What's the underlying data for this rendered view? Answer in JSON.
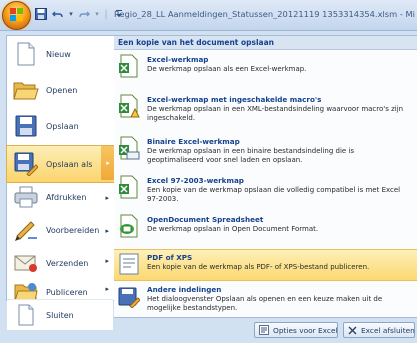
{
  "window": {
    "title": "Regio_28_LL Aanmeldingen_Statussen_20121119 1353314354.xlsm - Mi"
  },
  "quick_access": {
    "items": [
      "save-icon",
      "undo-icon",
      "redo-icon",
      "customize-icon"
    ],
    "separator": "|",
    "dropdown": "▾"
  },
  "office_menu": {
    "left_items": [
      {
        "id": "nieuw",
        "label": "Nieuw",
        "icon": "new-document-icon"
      },
      {
        "id": "openen",
        "label": "Openen",
        "icon": "open-folder-icon"
      },
      {
        "id": "opslaan",
        "label": "Opslaan",
        "icon": "save-disk-icon"
      },
      {
        "id": "opslaan-als",
        "label": "Opslaan als",
        "icon": "save-as-icon",
        "arrow": "▸",
        "active": true
      },
      {
        "id": "afdrukken",
        "label": "Afdrukken",
        "icon": "printer-icon",
        "arrow": "▸"
      },
      {
        "id": "voorbereiden",
        "label": "Voorbereiden",
        "icon": "prepare-pen-icon",
        "arrow": "▸"
      },
      {
        "id": "verzenden",
        "label": "Verzenden",
        "icon": "send-mail-icon",
        "arrow": "▸"
      },
      {
        "id": "publiceren",
        "label": "Publiceren",
        "icon": "publish-folder-icon",
        "arrow": "▸"
      },
      {
        "id": "sluiten",
        "label": "Sluiten",
        "icon": "close-document-icon"
      }
    ],
    "submenu": {
      "header": "Een kopie van het document opslaan",
      "items": [
        {
          "id": "excel-werkmap",
          "title": "Excel-werkmap",
          "desc": "De werkmap opslaan als een Excel-werkmap.",
          "icon": "excel-workbook-icon"
        },
        {
          "id": "excel-macro",
          "title": "Excel-werkmap met ingeschakelde macro's",
          "desc": "De werkmap opslaan in een XML-bestandsindeling waarvoor macro's zijn ingeschakeld.",
          "icon": "excel-macro-icon"
        },
        {
          "id": "binaire",
          "title": "Binaire Excel-werkmap",
          "desc": "De werkmap opslaan in een binaire bestandsindeling die is geoptimaliseerd voor snel laden en opslaan.",
          "icon": "excel-binary-icon"
        },
        {
          "id": "excel97",
          "title": "Excel 97-2003-werkmap",
          "desc": "Een kopie van de werkmap opslaan die volledig compatibel is met Excel 97-2003.",
          "icon": "excel-97-icon"
        },
        {
          "id": "opendocument",
          "title": "OpenDocument Spreadsheet",
          "desc": "De werkmap opslaan in Open Document Format.",
          "icon": "opendocument-icon"
        },
        {
          "id": "pdf-xps",
          "title": "PDF of XPS",
          "desc": "Een kopie van de werkmap als PDF- of XPS-bestand publiceren.",
          "icon": "pdf-xps-icon",
          "highlighted": true
        },
        {
          "id": "andere",
          "title": "Andere indelingen",
          "desc": "Het dialoogvenster Opslaan als openen en een keuze maken uit de mogelijke bestandstypen.",
          "icon": "other-formats-icon"
        }
      ]
    },
    "footer": {
      "options_label": "Opties voor Excel",
      "exit_label": "Excel afsluiten"
    }
  },
  "colors": {
    "accent": "#15428b",
    "highlight": "#fbd870",
    "frame": "#d2e1f2"
  }
}
